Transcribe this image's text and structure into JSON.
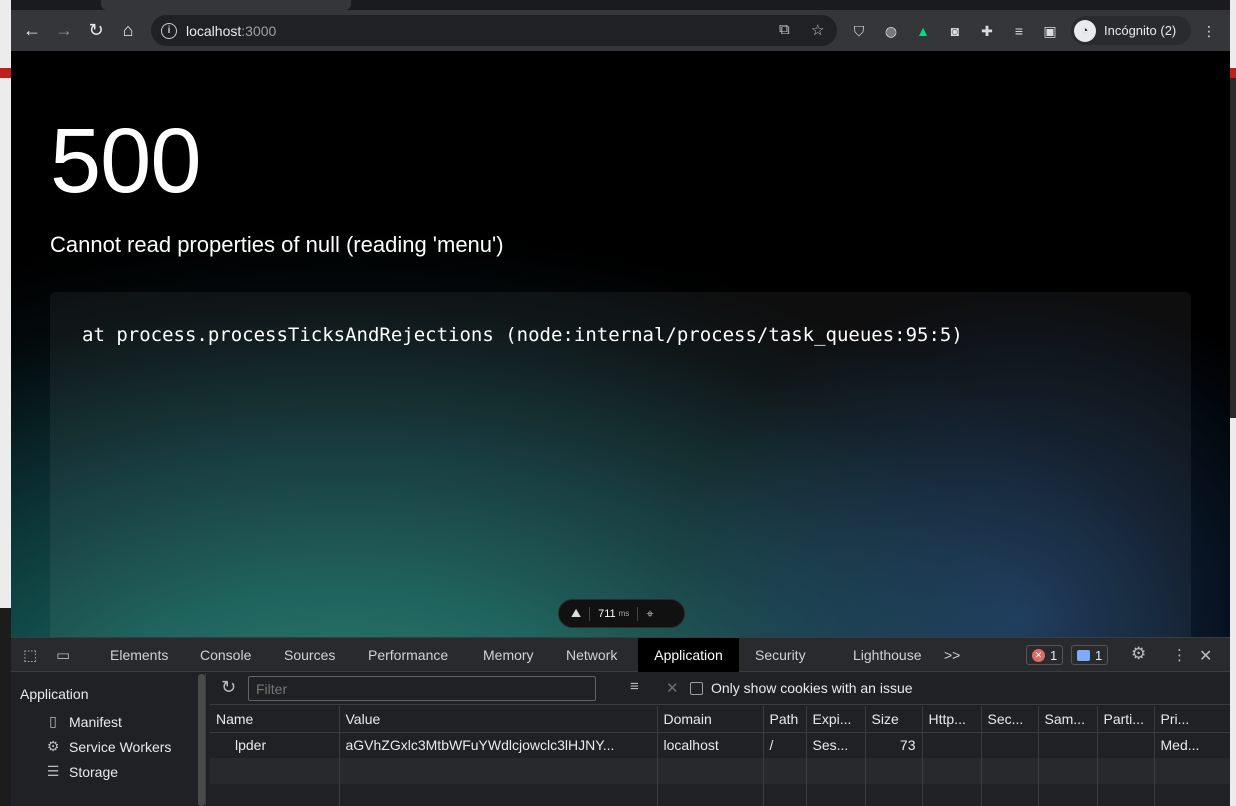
{
  "browser": {
    "url_host": "localhost",
    "url_port": ":3000",
    "profile_label": "Incógnito (2)"
  },
  "page": {
    "status_code": "500",
    "error_message": "Cannot read properties of null (reading 'menu')",
    "stack_line": "at process.processTicksAndRejections (node:internal/process/task_queues:95:5)",
    "nuxt_timing": "711",
    "nuxt_timing_unit": "ms"
  },
  "devtools": {
    "tabs": [
      "Elements",
      "Console",
      "Sources",
      "Performance",
      "Memory",
      "Network",
      "Application",
      "Security",
      "Lighthouse"
    ],
    "active_tab": "Application",
    "more_tabs": ">>",
    "error_count": "1",
    "message_count": "1",
    "sidebar": {
      "heading": "Application",
      "items": [
        "Manifest",
        "Service Workers",
        "Storage"
      ]
    },
    "filter_placeholder": "Filter",
    "only_issue_label": "Only show cookies with an issue",
    "columns": [
      "Name",
      "Value",
      "Domain",
      "Path",
      "Expi...",
      "Size",
      "Http...",
      "Sec...",
      "Sam...",
      "Parti...",
      "Pri..."
    ],
    "rows": [
      [
        "lpder",
        "aGVhZGxlc3MtbWFuYWdlcjowclc3lHJNY...",
        "localhost",
        "/",
        "Ses...",
        "73",
        "",
        "",
        "",
        "",
        "Med..."
      ]
    ]
  },
  "colors": {
    "accent_green": "#00dc82",
    "error_red": "#e46962",
    "info_blue": "#7cacf8"
  }
}
